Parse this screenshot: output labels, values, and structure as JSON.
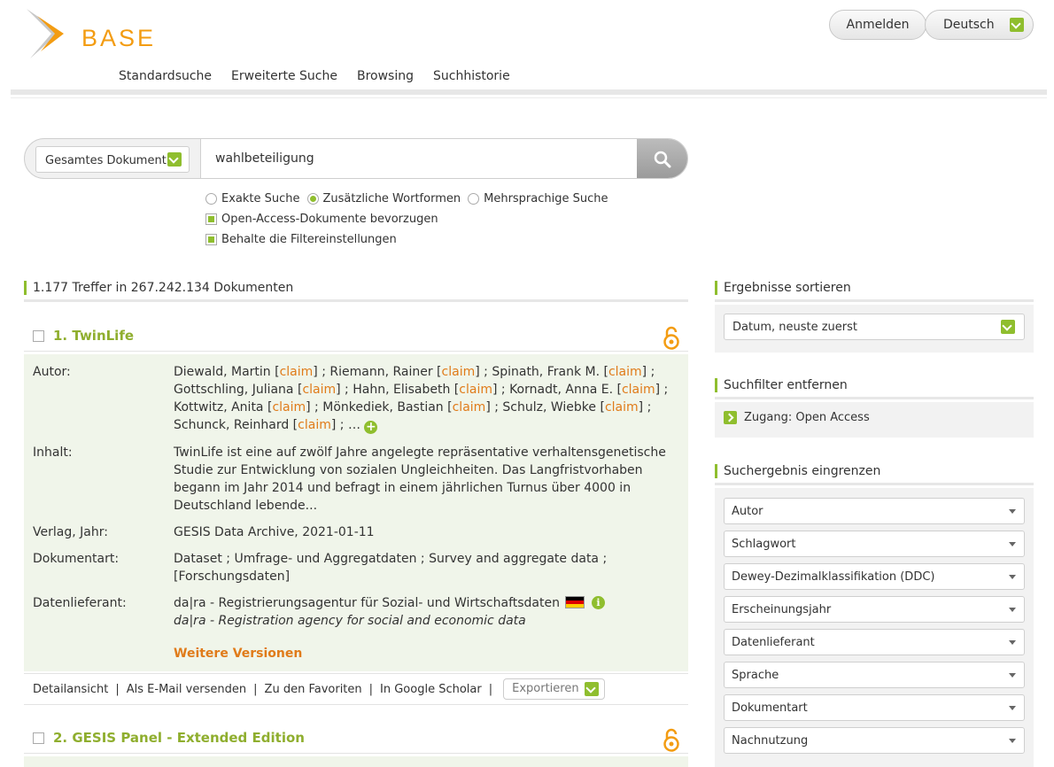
{
  "header": {
    "logo_text": "BASE",
    "nav": [
      "Standardsuche",
      "Erweiterte Suche",
      "Browsing",
      "Suchhistorie"
    ],
    "login_label": "Anmelden",
    "language_label": "Deutsch"
  },
  "search": {
    "field_label": "Gesamtes Dokument",
    "query": "wahlbeteiligung",
    "options": {
      "exact": "Exakte Suche",
      "additional": "Zusätzliche Wortformen",
      "multilingual": "Mehrsprachige Suche",
      "prefer_oa": "Open-Access-Dokumente bevorzugen",
      "keep_filters": "Behalte die Filtereinstellungen"
    },
    "selected_option": "additional"
  },
  "results": {
    "count_text": "1.177 Treffer in 267.242.134 Dokumenten",
    "items": [
      {
        "title": "1. TwinLife",
        "labels": {
          "author": "Autor:",
          "content": "Inhalt:",
          "publisher": "Verlag, Jahr:",
          "doctype": "Dokumentart:",
          "provider": "Datenlieferant:"
        },
        "authors": [
          "Diewald, Martin",
          "Riemann, Rainer",
          "Spinath, Frank M.",
          "Gottschling, Juliana",
          "Hahn, Elisabeth",
          "Kornadt, Anna E.",
          "Kottwitz, Anita",
          "Mönkediek, Bastian",
          "Schulz, Wiebke",
          "Schunck, Reinhard"
        ],
        "claim_label": "claim",
        "content": "TwinLife ist eine auf zwölf Jahre angelegte repräsentative verhaltensgenetische Studie zur Entwicklung von sozialen Ungleichheiten. Das Langfristvorhaben begann im Jahr 2014 und befragt in einem jährlichen Turnus über 4000 in Deutschland lebende...",
        "publisher": "GESIS Data Archive, 2021-01-11",
        "doctype": "Dataset ; Umfrage- und Aggregatdaten ; Survey and aggregate data ; [Forschungsdaten]",
        "provider": "da|ra - Registrierungsagentur für Sozial- und Wirtschaftsdaten",
        "provider_en": "da|ra - Registration agency for social and economic data",
        "more_versions": "Weitere Versionen"
      },
      {
        "title": "2. GESIS Panel - Extended Edition"
      }
    ],
    "actions": {
      "detail": "Detailansicht",
      "email": "Als E-Mail versenden",
      "favorites": "Zu den Favoriten",
      "scholar": "In Google Scholar",
      "export": "Exportieren"
    }
  },
  "sidebar": {
    "sort_heading": "Ergebnisse sortieren",
    "sort_value": "Datum, neuste zuerst",
    "remove_heading": "Suchfilter entfernen",
    "active_filter": "Zugang: Open Access",
    "refine_heading": "Suchergebnis eingrenzen",
    "facets": [
      "Autor",
      "Schlagwort",
      "Dewey-Dezimalklassifikation (DDC)",
      "Erscheinungsjahr",
      "Datenlieferant",
      "Sprache",
      "Dokumentart",
      "Nachnutzung"
    ]
  },
  "colors": {
    "accent_green": "#8fbe2e",
    "accent_orange": "#e07b1a",
    "logo_orange": "#f39c12"
  }
}
